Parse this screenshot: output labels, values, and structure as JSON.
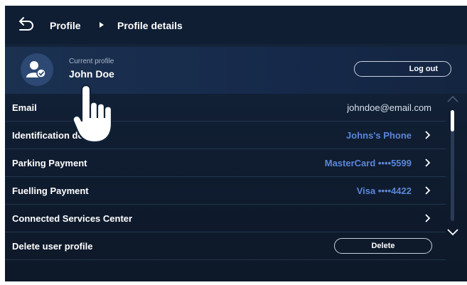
{
  "header": {
    "breadcrumb": [
      "Profile",
      "Profile details"
    ]
  },
  "profile": {
    "caption": "Current profile",
    "name": "John Doe",
    "logout_label": "Log out"
  },
  "rows": [
    {
      "label": "Email",
      "value": "johndoe@email.com"
    },
    {
      "label": "Identification device",
      "value": "Johns's Phone"
    },
    {
      "label": "Parking Payment",
      "value": "MasterCard ••••5599"
    },
    {
      "label": "Fuelling Payment",
      "value": "Visa ••••4422"
    },
    {
      "label": "Connected Services Center",
      "value": ""
    },
    {
      "label": "Delete user profile",
      "button": "Delete"
    }
  ],
  "colors": {
    "background": "#101d31",
    "accent_value": "#5a87d8",
    "text": "#ffffff"
  },
  "icons": [
    "back-arrow-icon",
    "breadcrumb-separator-icon",
    "user-check-icon",
    "chevron-right-icon",
    "scroll-up-icon",
    "scroll-down-icon",
    "touch-hand-icon"
  ]
}
